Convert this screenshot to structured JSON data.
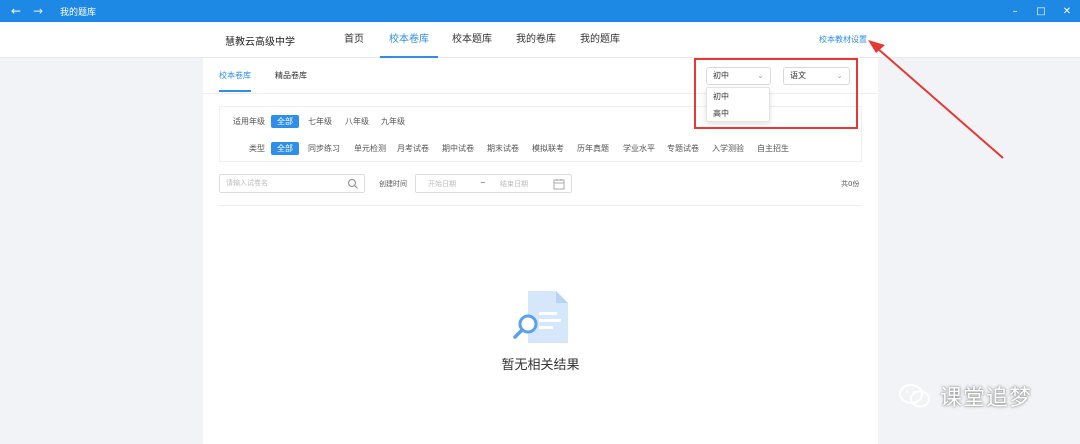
{
  "window": {
    "title": "我的题库",
    "back_icon": "arrow-left-icon",
    "forward_icon": "arrow-right-icon",
    "controls": [
      "minimize-icon",
      "maximize-icon",
      "close-icon"
    ]
  },
  "header": {
    "school": "慧教云高级中学",
    "tabs": [
      {
        "label": "首页",
        "active": false
      },
      {
        "label": "校本卷库",
        "active": true
      },
      {
        "label": "校本题库",
        "active": false
      },
      {
        "label": "我的卷库",
        "active": false
      },
      {
        "label": "我的题库",
        "active": false
      }
    ],
    "settings_link": "校本教材设置"
  },
  "subtabs": [
    {
      "label": "校本卷库",
      "active": true
    },
    {
      "label": "精品卷库",
      "active": false
    }
  ],
  "selects": {
    "level": {
      "value": "初中",
      "options": [
        "初中",
        "高中"
      ],
      "open": true
    },
    "subject": {
      "value": "语文"
    }
  },
  "filters": {
    "grade_label": "适用年级",
    "grades": [
      "全部",
      "七年级",
      "八年级",
      "九年级"
    ],
    "type_label": "类型",
    "types": [
      "全部",
      "同步练习",
      "单元检测",
      "月考试卷",
      "期中试卷",
      "期末试卷",
      "模拟联考",
      "历年真题",
      "学业水平",
      "专题试卷",
      "入学测验",
      "自主招生"
    ]
  },
  "search": {
    "placeholder": "请输入试卷名"
  },
  "date": {
    "label": "创建时间",
    "start_placeholder": "开始日期",
    "sep": "~",
    "end_placeholder": "结束日期"
  },
  "count": "共0份",
  "empty": {
    "text": "暂无相关结果"
  },
  "watermark": "课堂追梦",
  "colors": {
    "primary": "#2f8fe8",
    "titlebar": "#1e88e5",
    "highlight": "#e53935"
  }
}
